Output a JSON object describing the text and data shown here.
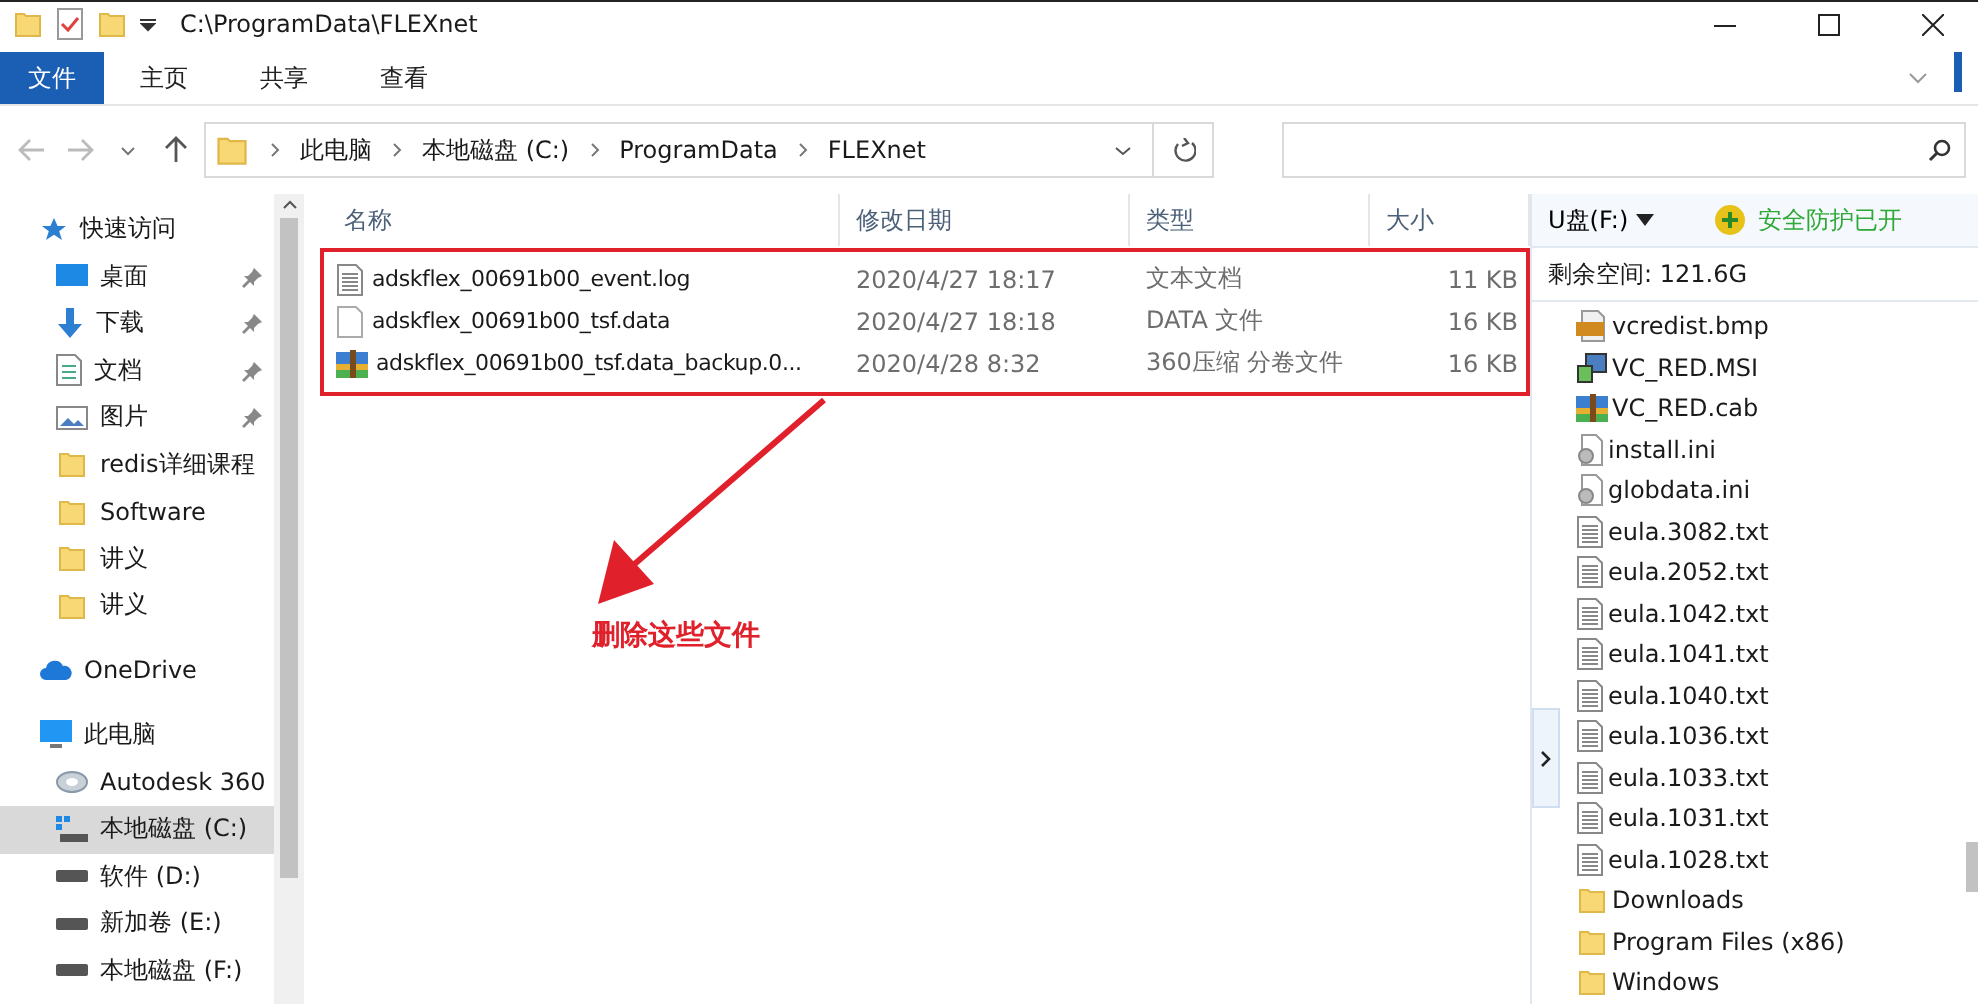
{
  "window": {
    "title": "C:\\ProgramData\\FLEXnet"
  },
  "ribbon_tabs": [
    {
      "label": "文件",
      "selected": true
    },
    {
      "label": "主页",
      "selected": false
    },
    {
      "label": "共享",
      "selected": false
    },
    {
      "label": "查看",
      "selected": false
    }
  ],
  "breadcrumb": [
    "此电脑",
    "本地磁盘 (C:)",
    "ProgramData",
    "FLEXnet"
  ],
  "sidebar": {
    "items": [
      {
        "label": "快速访问",
        "kind": "quick",
        "selected": false,
        "children": [
          {
            "label": "桌面",
            "kind": "desktop",
            "pinned": true,
            "selected": false
          },
          {
            "label": "下载",
            "kind": "download",
            "pinned": true,
            "selected": false
          },
          {
            "label": "文档",
            "kind": "document",
            "pinned": true,
            "selected": false
          },
          {
            "label": "图片",
            "kind": "image",
            "pinned": true,
            "selected": false
          },
          {
            "label": "redis详细课程",
            "kind": "folder",
            "pinned": false,
            "selected": false
          },
          {
            "label": "Software",
            "kind": "folder",
            "pinned": false,
            "selected": false
          },
          {
            "label": "讲义",
            "kind": "folder",
            "pinned": false,
            "selected": false
          },
          {
            "label": "讲义",
            "kind": "folder",
            "pinned": false,
            "selected": false
          }
        ]
      },
      {
        "label": "OneDrive",
        "kind": "cloud",
        "selected": false
      },
      {
        "label": "此电脑",
        "kind": "pc",
        "selected": false,
        "children": [
          {
            "label": "Autodesk 360",
            "kind": "autodesk",
            "pinned": false,
            "selected": false
          },
          {
            "label": "本地磁盘 (C:)",
            "kind": "sysdrive",
            "pinned": false,
            "selected": true
          },
          {
            "label": "软件 (D:)",
            "kind": "drive",
            "pinned": false,
            "selected": false
          },
          {
            "label": "新加卷 (E:)",
            "kind": "drive",
            "pinned": false,
            "selected": false
          },
          {
            "label": "本地磁盘 (F:)",
            "kind": "drive",
            "pinned": false,
            "selected": false
          }
        ]
      }
    ]
  },
  "table": {
    "columns": [
      "名称",
      "修改日期",
      "类型",
      "大小"
    ],
    "rows": [
      {
        "name": "adskflex_00691b00_event.log",
        "kind": "text",
        "date": "2020/4/27 18:17",
        "type": "文本文档",
        "size": "11 KB"
      },
      {
        "name": "adskflex_00691b00_tsf.data",
        "kind": "blank",
        "date": "2020/4/27 18:18",
        "type": "DATA 文件",
        "size": "16 KB"
      },
      {
        "name": "adskflex_00691b00_tsf.data_backup.0...",
        "kind": "archive",
        "date": "2020/4/28 8:32",
        "type": "360压缩 分卷文件",
        "size": "16 KB"
      }
    ]
  },
  "annotation": {
    "label": "删除这些文件"
  },
  "side_panel": {
    "drive": "U盘(F:)",
    "protection": "安全防护已开",
    "free_space": "剩余空间: 121.6G",
    "files": [
      {
        "name": "vcredist.bmp",
        "kind": "bmp"
      },
      {
        "name": "VC_RED.MSI",
        "kind": "msi"
      },
      {
        "name": "VC_RED.cab",
        "kind": "archive"
      },
      {
        "name": "install.ini",
        "kind": "ini"
      },
      {
        "name": "globdata.ini",
        "kind": "ini"
      },
      {
        "name": "eula.3082.txt",
        "kind": "text"
      },
      {
        "name": "eula.2052.txt",
        "kind": "text"
      },
      {
        "name": "eula.1042.txt",
        "kind": "text"
      },
      {
        "name": "eula.1041.txt",
        "kind": "text"
      },
      {
        "name": "eula.1040.txt",
        "kind": "text"
      },
      {
        "name": "eula.1036.txt",
        "kind": "text"
      },
      {
        "name": "eula.1033.txt",
        "kind": "text"
      },
      {
        "name": "eula.1031.txt",
        "kind": "text"
      },
      {
        "name": "eula.1028.txt",
        "kind": "text"
      },
      {
        "name": "Downloads",
        "kind": "folder"
      },
      {
        "name": "Program Files (x86)",
        "kind": "folder"
      },
      {
        "name": "Windows",
        "kind": "folder"
      }
    ]
  }
}
